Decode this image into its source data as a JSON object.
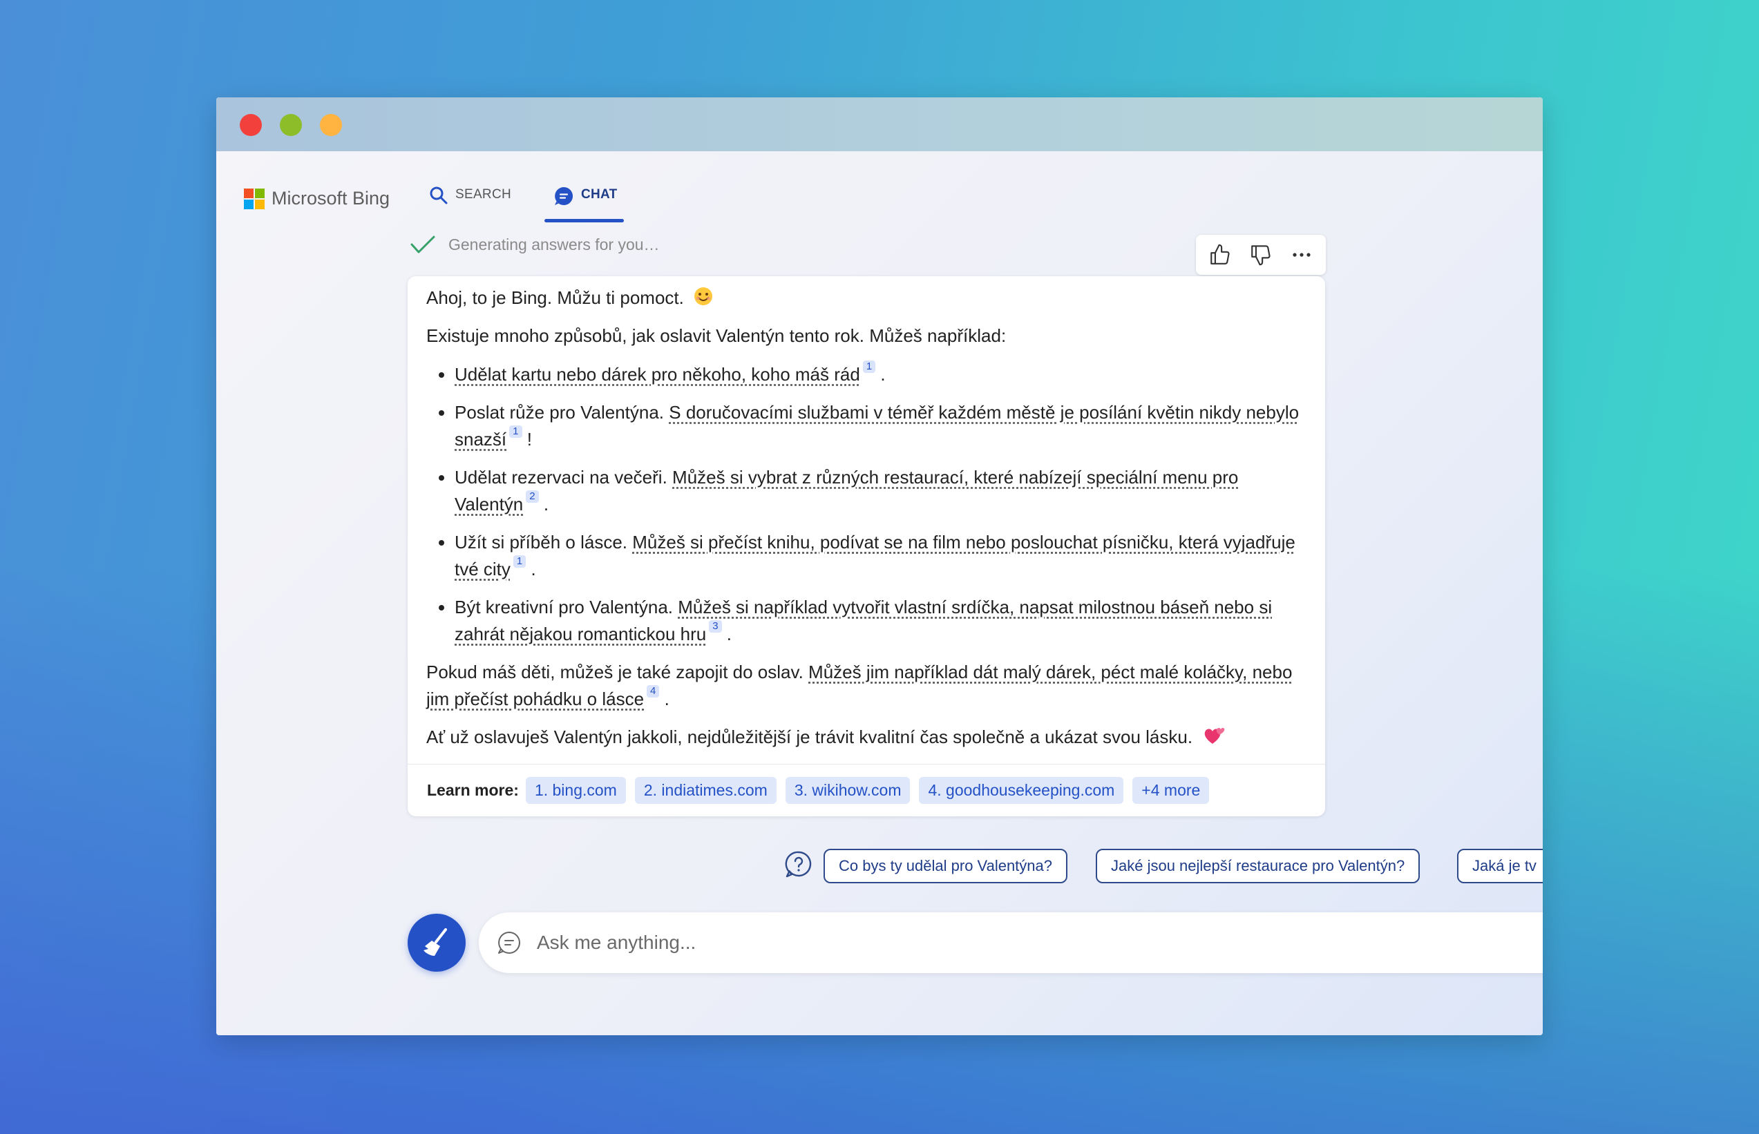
{
  "brand": {
    "name": "Microsoft Bing",
    "colors": [
      "#f25022",
      "#7fba00",
      "#00a4ef",
      "#ffb900"
    ]
  },
  "tabs": {
    "search": "SEARCH",
    "chat": "CHAT"
  },
  "status": "Generating answers for you…",
  "message": {
    "greeting": "Ahoj, to je Bing. Můžu ti pomoct.",
    "intro": "Existuje mnoho způsobů, jak oslavit Valentýn tento rok. Můžeš například:",
    "items": [
      {
        "plain": "",
        "linked": "Udělat kartu nebo dárek pro někoho, koho máš rád",
        "ref": "1",
        "after": "."
      },
      {
        "plain": "Poslat růže pro Valentýna. ",
        "linked": "S doručovacími službami v téměř každém městě je posílání květin nikdy nebylo snazší",
        "ref": "1",
        "after": "!"
      },
      {
        "plain": "Udělat rezervaci na večeři. ",
        "linked": "Můžeš si vybrat z různých restaurací, které nabízejí speciální menu pro Valentýn",
        "ref": "2",
        "after": "."
      },
      {
        "plain": "Užít si příběh o lásce. ",
        "linked": "Můžeš si přečíst knihu, podívat se na film nebo poslouchat písničku, která vyjadřuje tvé city",
        "ref": "1",
        "after": "."
      },
      {
        "plain": "Být kreativní pro Valentýna. ",
        "linked": "Můžeš si například vytvořit vlastní srdíčka, napsat milostnou báseň nebo si zahrát nějakou romantickou hru",
        "ref": "3",
        "after": "."
      }
    ],
    "kids": {
      "plain": "Pokud máš děti, můžeš je také zapojit do oslav. ",
      "linked": "Můžeš jim například dát malý dárek, péct malé koláčky, nebo jim přečíst pohádku o lásce",
      "ref": "4",
      "after": "."
    },
    "closing": "Ať už oslavuješ Valentýn jakkoli, nejdůležitější je trávit kvalitní čas společně a ukázat svou lásku."
  },
  "learn_more": {
    "label": "Learn more:",
    "links": [
      "1. bing.com",
      "2. indiatimes.com",
      "3. wikihow.com",
      "4. goodhousekeeping.com",
      "+4 more"
    ]
  },
  "suggestions": [
    "Co bys ty udělal pro Valentýna?",
    "Jaké jsou nejlepší restaurace pro Valentýn?",
    "Jaká je tv"
  ],
  "input": {
    "placeholder": "Ask me anything..."
  },
  "icons": [
    "search-icon",
    "chat-icon",
    "check-icon",
    "thumbs-up-icon",
    "thumbs-down-icon",
    "more-icon",
    "smile-emoji-icon",
    "two-hearts-emoji-icon",
    "question-icon",
    "broom-icon",
    "chat-bubble-icon"
  ]
}
